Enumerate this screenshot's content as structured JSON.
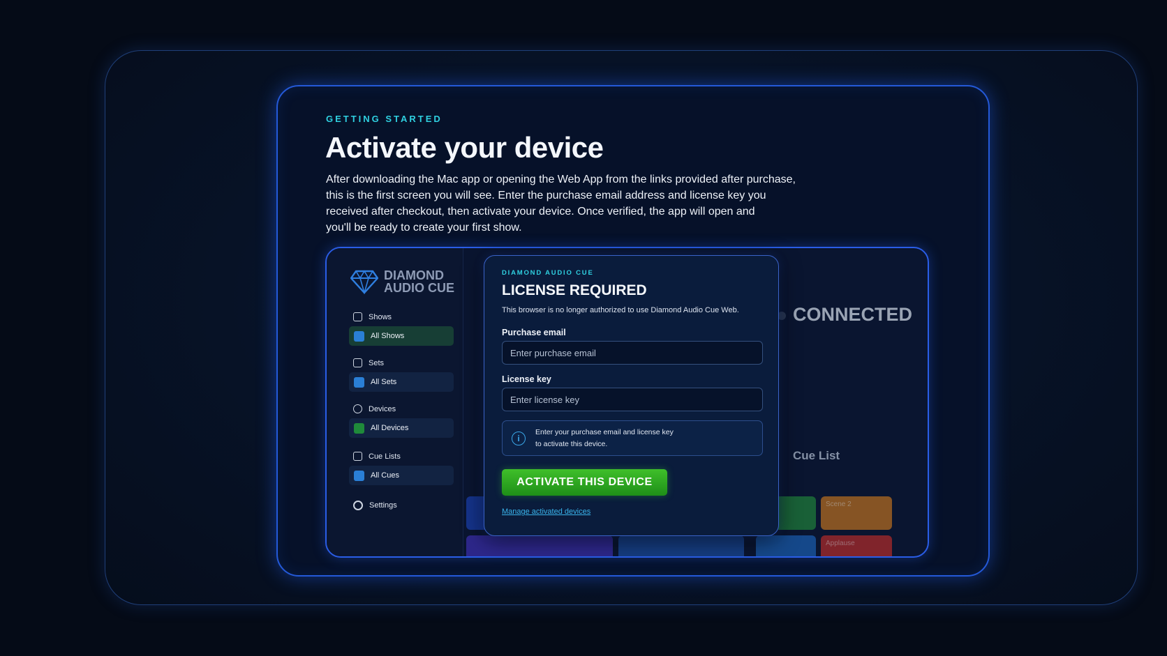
{
  "section": {
    "eyebrow": "GETTING STARTED",
    "title": "Activate your device",
    "description_lines": [
      "After downloading the Mac app or opening the Web App from the links provided after purchase,",
      "this is the first screen you will see. Enter the purchase email address and license key you",
      "received after checkout, then activate your device. Once verified, the app will open and",
      "you'll be ready to create your first show."
    ]
  },
  "app": {
    "logo": {
      "line1": "DIAMOND",
      "line2": "AUDIO CUE",
      "icon": "diamond-icon"
    },
    "sidebar": {
      "shows": {
        "heading": "Shows",
        "item": "All Shows"
      },
      "sets": {
        "heading": "Sets",
        "item": "All Sets"
      },
      "devices": {
        "heading": "Devices",
        "item": "All Devices"
      },
      "cue_lists": {
        "heading": "Cue Lists",
        "item": "All Cues"
      },
      "settings": "Settings"
    },
    "status": "CONNECTED",
    "cue_list_title": "Cue List",
    "tiles": [
      "Scene 2",
      "Applause"
    ],
    "colors": {
      "accent_cyan": "#2fd0e0",
      "activate_green": "#2fa622",
      "frame_blue": "#2459d8"
    }
  },
  "modal": {
    "eyebrow": "DIAMOND AUDIO CUE",
    "title": "LICENSE REQUIRED",
    "subtitle": "This browser is no longer authorized to use Diamond Audio Cue Web.",
    "email_label": "Purchase email",
    "email_placeholder": "Enter purchase email",
    "email_value": "",
    "key_label": "License key",
    "key_placeholder": "Enter license key",
    "key_value": "",
    "info_line1": "Enter your purchase email and license key",
    "info_line2": "to activate this device.",
    "activate_label": "ACTIVATE THIS DEVICE",
    "manage_link": "Manage activated devices"
  }
}
